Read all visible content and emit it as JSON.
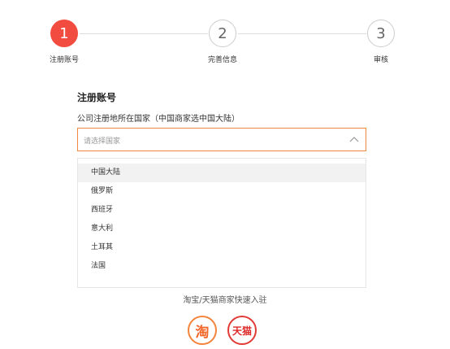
{
  "steps": [
    {
      "number": "1",
      "label": "注册账号",
      "state": "active"
    },
    {
      "number": "2",
      "label": "完善信息",
      "state": "inactive"
    },
    {
      "number": "3",
      "label": "审核",
      "state": "inactive"
    }
  ],
  "form": {
    "title": "注册账号",
    "country_label": "公司注册地所在国家（中国商家选中国大陆）",
    "country_placeholder": "请选择国家",
    "options": [
      "中国大陆",
      "俄罗斯",
      "西班牙",
      "意大利",
      "土耳其",
      "法国"
    ],
    "highlighted_option": "中国大陆"
  },
  "quick_entry": {
    "text": "淘宝/天猫商家快速入驻",
    "taobao_label": "淘",
    "tmall_label": "天猫"
  },
  "colors": {
    "accent": "#f24b40",
    "select_border": "#f08a3e",
    "taobao": "#f5833c",
    "tmall": "#e23a35"
  },
  "icons": {
    "select_arrow": "chevron-up-icon"
  }
}
